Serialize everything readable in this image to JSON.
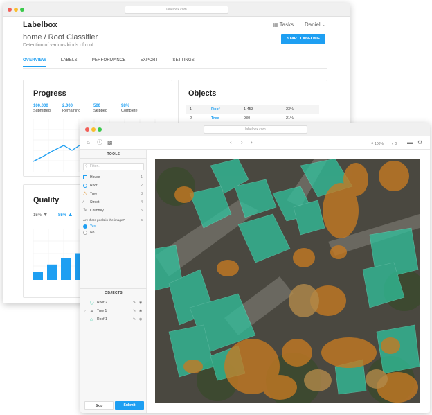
{
  "colors": {
    "accent": "#1e9ff2",
    "teal": "#2fc6a0",
    "orange": "#c77a22",
    "tan": "#b28a4a"
  },
  "browser": {
    "url": "labelbox.com"
  },
  "app": {
    "brand": "Labelbox",
    "tasks_label": "Tasks",
    "user_name": "Daniel",
    "breadcrumb": "home / Roof Classifier",
    "subtitle": "Detection of various kinds of roof",
    "start_button": "START LABELING",
    "tabs": [
      "OVERVIEW",
      "LABELS",
      "PERFORMANCE",
      "EXPORT",
      "SETTINGS"
    ]
  },
  "progress": {
    "title": "Progress",
    "stats": [
      {
        "value": "100,000",
        "label": "Submitted"
      },
      {
        "value": "2,000",
        "label": "Remaining"
      },
      {
        "value": "500",
        "label": "Skipped"
      },
      {
        "value": "98%",
        "label": "Complete"
      }
    ]
  },
  "objects_card": {
    "title": "Objects",
    "rows": [
      {
        "num": "1",
        "name": "Roof",
        "count": "1,453",
        "pct": "23%"
      },
      {
        "num": "2",
        "name": "Tree",
        "count": "930",
        "pct": "21%"
      }
    ]
  },
  "quality": {
    "title": "Quality",
    "down_pct": "15%",
    "up_pct": "85%",
    "bars": [
      0.15,
      0.3,
      0.42,
      0.52
    ]
  },
  "editor": {
    "url": "labelbox.com",
    "zoom": "100%",
    "count": "0",
    "tools_header": "TOOLS",
    "filter_placeholder": "Filter...",
    "tools": [
      {
        "name": "House",
        "hotkey": "1",
        "icon": "square-icon"
      },
      {
        "name": "Roof",
        "hotkey": "2",
        "icon": "circle-icon"
      },
      {
        "name": "Tree",
        "hotkey": "3",
        "icon": "polygon-icon"
      },
      {
        "name": "Street",
        "hotkey": "4",
        "icon": "line-icon"
      },
      {
        "name": "Chimney",
        "hotkey": "5",
        "icon": "pencil-icon"
      }
    ],
    "question": "Are there pools in the image?",
    "question_hotkey": "6",
    "options": [
      "Yes",
      "No"
    ],
    "objects_header": "OBJECTS",
    "objects": [
      "Roof 2",
      "Tree 1",
      "Roof 1"
    ],
    "skip_label": "Skip",
    "submit_label": "Submit"
  }
}
